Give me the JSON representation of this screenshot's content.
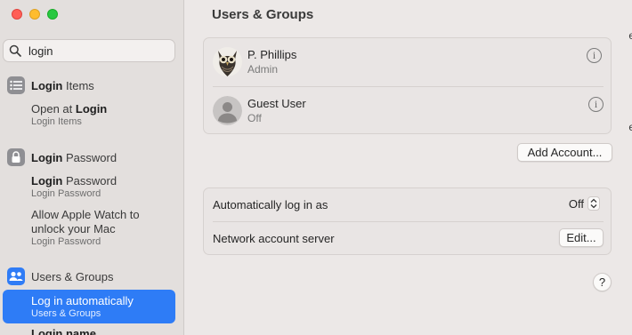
{
  "sidebar": {
    "search": {
      "value": "login",
      "placeholder": ""
    },
    "sections": [
      {
        "heading_bold": "Login",
        "heading_rest": " Items",
        "results": [
          {
            "title_bold": "Login",
            "title_pre": "Open at ",
            "sub": "Login Items"
          }
        ]
      },
      {
        "heading_bold": "Login",
        "heading_rest": " Password",
        "results": [
          {
            "title_bold": "Login",
            "title_rest": " Password",
            "sub": "Login Password"
          },
          {
            "title_line1": "Allow Apple Watch to",
            "title_line2": "unlock your Mac",
            "sub": "Login Password"
          }
        ]
      },
      {
        "heading": "Users & Groups",
        "results": [
          {
            "title": "Log in automatically",
            "sub": "Users & Groups"
          },
          {
            "title_partial": "Login name"
          }
        ]
      }
    ]
  },
  "main": {
    "title": "Users & Groups",
    "users": [
      {
        "name": "P. Phillips",
        "role": "Admin",
        "avatar": "owl-avatar"
      },
      {
        "name": "Guest User",
        "role": "Off",
        "avatar": "person-placeholder"
      }
    ],
    "add_account_label": "Add Account...",
    "settings": [
      {
        "label": "Automatically log in as",
        "value": "Off"
      },
      {
        "label": "Network account server",
        "button": "Edit..."
      }
    ],
    "help_label": "?",
    "edge_glyphs": [
      "e",
      "e"
    ]
  },
  "colors": {
    "accent": "#2e7cf6",
    "sidebar_bg": "#e3dfdd",
    "main_bg": "#ece8e7"
  }
}
